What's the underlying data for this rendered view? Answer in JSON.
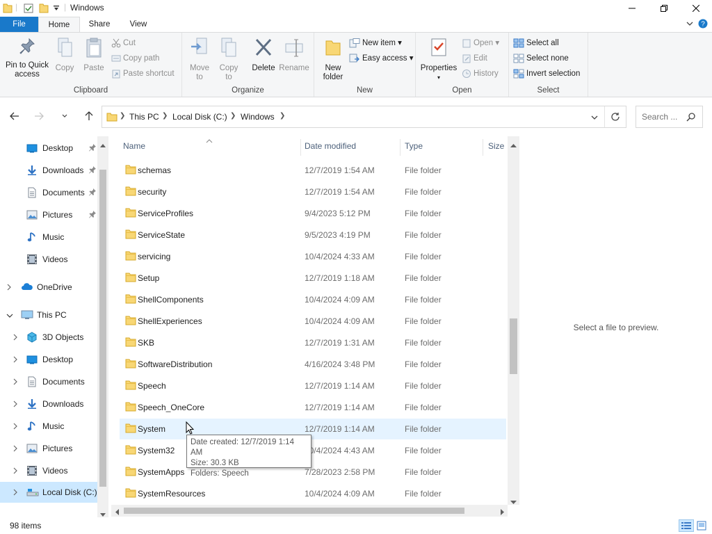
{
  "window": {
    "title": "Windows",
    "minimize_glyph": "—",
    "close_glyph": "✕"
  },
  "ribbon_tabs": {
    "file": "File",
    "home": "Home",
    "share": "Share",
    "view": "View"
  },
  "ribbon": {
    "clipboard": {
      "label": "Clipboard",
      "pin_to_quick_access": "Pin to Quick access",
      "copy": "Copy",
      "paste": "Paste",
      "cut": "Cut",
      "copy_path": "Copy path",
      "paste_shortcut": "Paste shortcut"
    },
    "organize": {
      "label": "Organize",
      "move_to": "Move to",
      "copy_to": "Copy to",
      "delete": "Delete",
      "rename": "Rename"
    },
    "new": {
      "label": "New",
      "new_folder": "New folder",
      "new_item": "New item",
      "easy_access": "Easy access"
    },
    "open": {
      "label": "Open",
      "properties": "Properties",
      "open": "Open",
      "edit": "Edit",
      "history": "History"
    },
    "select": {
      "label": "Select",
      "select_all": "Select all",
      "select_none": "Select none",
      "invert_selection": "Invert selection"
    }
  },
  "address": {
    "crumbs": [
      "This PC",
      "Local Disk (C:)",
      "Windows"
    ],
    "search_placeholder": "Search ..."
  },
  "nav_pane": {
    "items": [
      {
        "label": "Desktop",
        "icon": "desktop-icon",
        "pinned": true
      },
      {
        "label": "Downloads",
        "icon": "downloads-icon",
        "pinned": true
      },
      {
        "label": "Documents",
        "icon": "documents-icon",
        "pinned": true
      },
      {
        "label": "Pictures",
        "icon": "pictures-icon",
        "pinned": true
      },
      {
        "label": "Music",
        "icon": "music-icon",
        "pinned": false
      },
      {
        "label": "Videos",
        "icon": "videos-icon",
        "pinned": false
      },
      {
        "label": "OneDrive",
        "icon": "onedrive-icon",
        "pinned": false
      },
      {
        "label": "This PC",
        "icon": "this-pc-icon",
        "pinned": false
      },
      {
        "label": "3D Objects",
        "icon": "3d-objects-icon",
        "pinned": false
      },
      {
        "label": "Desktop",
        "icon": "desktop-icon",
        "pinned": false
      },
      {
        "label": "Documents",
        "icon": "documents-icon",
        "pinned": false
      },
      {
        "label": "Downloads",
        "icon": "downloads-icon",
        "pinned": false
      },
      {
        "label": "Music",
        "icon": "music-icon",
        "pinned": false
      },
      {
        "label": "Pictures",
        "icon": "pictures-icon",
        "pinned": false
      },
      {
        "label": "Videos",
        "icon": "videos-icon",
        "pinned": false
      },
      {
        "label": "Local Disk (C:)",
        "icon": "local-disk-icon",
        "pinned": false
      }
    ]
  },
  "file_list": {
    "columns": {
      "name": "Name",
      "date_modified": "Date modified",
      "type": "Type",
      "size": "Size"
    },
    "rows": [
      {
        "name": "schemas",
        "date": "12/7/2019 1:54 AM",
        "type": "File folder"
      },
      {
        "name": "security",
        "date": "12/7/2019 1:54 AM",
        "type": "File folder"
      },
      {
        "name": "ServiceProfiles",
        "date": "9/4/2023 5:12 PM",
        "type": "File folder"
      },
      {
        "name": "ServiceState",
        "date": "9/5/2023 4:19 PM",
        "type": "File folder"
      },
      {
        "name": "servicing",
        "date": "10/4/2024 4:33 AM",
        "type": "File folder"
      },
      {
        "name": "Setup",
        "date": "12/7/2019 1:18 AM",
        "type": "File folder"
      },
      {
        "name": "ShellComponents",
        "date": "10/4/2024 4:09 AM",
        "type": "File folder"
      },
      {
        "name": "ShellExperiences",
        "date": "10/4/2024 4:09 AM",
        "type": "File folder"
      },
      {
        "name": "SKB",
        "date": "12/7/2019 1:31 AM",
        "type": "File folder"
      },
      {
        "name": "SoftwareDistribution",
        "date": "4/16/2024 3:48 PM",
        "type": "File folder"
      },
      {
        "name": "Speech",
        "date": "12/7/2019 1:14 AM",
        "type": "File folder"
      },
      {
        "name": "Speech_OneCore",
        "date": "12/7/2019 1:14 AM",
        "type": "File folder"
      },
      {
        "name": "System",
        "date": "12/7/2019 1:14 AM",
        "type": "File folder"
      },
      {
        "name": "System32",
        "date": "10/4/2024 4:43 AM",
        "type": "File folder"
      },
      {
        "name": "SystemApps",
        "date": "7/28/2023 2:58 PM",
        "type": "File folder"
      },
      {
        "name": "SystemResources",
        "date": "10/4/2024 4:09 AM",
        "type": "File folder"
      }
    ]
  },
  "tooltip": {
    "line1": "Date created: 12/7/2019 1:14 AM",
    "line2": "Size: 30.3 KB",
    "line3": "Folders: Speech"
  },
  "preview": {
    "text": "Select a file to preview."
  },
  "status": {
    "item_count": "98 items"
  },
  "colors": {
    "accent": "#1979ca",
    "folder": "#f8d775",
    "selection": "#cce8ff",
    "hover": "#e5f3ff"
  }
}
